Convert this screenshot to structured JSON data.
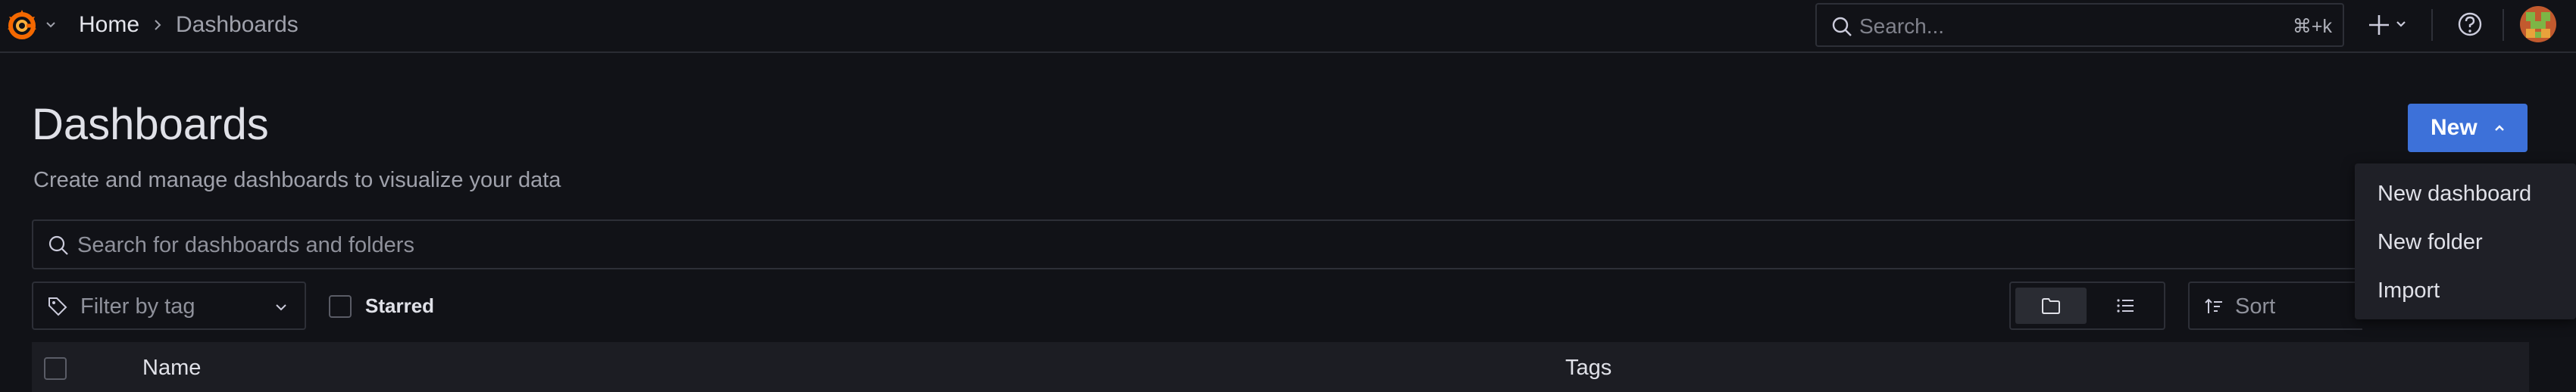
{
  "colors": {
    "background": "#111217",
    "primary_button": "#3d71d9",
    "logo_orange": "#f46800",
    "menu_background": "#1f2027"
  },
  "topbar": {
    "logo_icon": "grafana-logo",
    "breadcrumb": {
      "home": "Home",
      "current": "Dashboards"
    },
    "search": {
      "placeholder": "Search...",
      "shortcut": "⌘+k"
    },
    "icons": [
      "plus-icon",
      "help-icon",
      "avatar"
    ]
  },
  "page": {
    "title": "Dashboards",
    "subtitle": "Create and manage dashboards to visualize your data",
    "new_button": "New"
  },
  "new_menu": {
    "items": [
      {
        "label": "New dashboard"
      },
      {
        "label": "New folder"
      },
      {
        "label": "Import"
      }
    ]
  },
  "filters": {
    "search_placeholder": "Search for dashboards and folders",
    "tag_filter": "Filter by tag",
    "starred_label": "Starred",
    "starred_checked": false,
    "view_mode": "folders",
    "sort_label": "Sort"
  },
  "table": {
    "columns": [
      "Name",
      "Tags"
    ]
  }
}
